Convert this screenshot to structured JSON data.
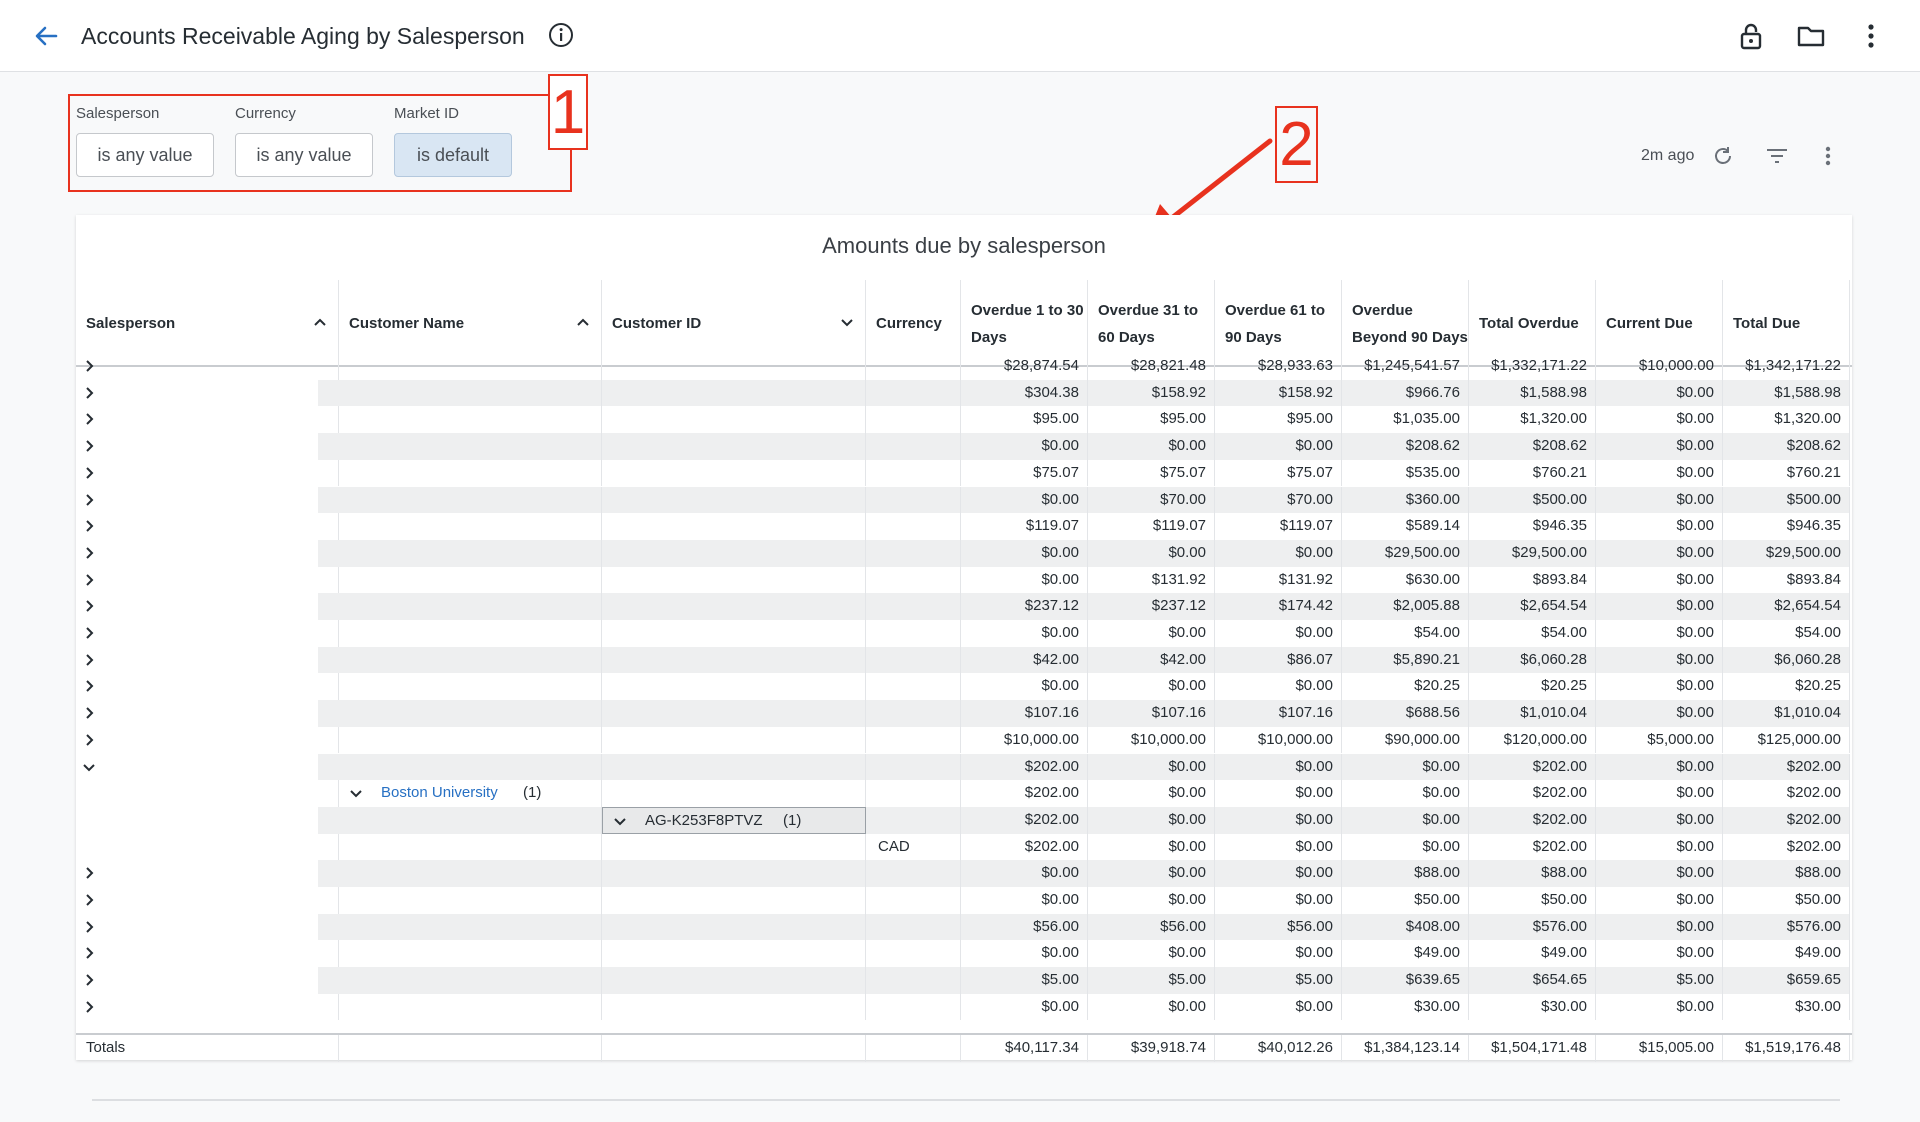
{
  "header": {
    "title": "Accounts Receivable Aging by Salesperson"
  },
  "filters": [
    {
      "label": "Salesperson",
      "value": "is any value"
    },
    {
      "label": "Currency",
      "value": "is any value"
    },
    {
      "label": "Market ID",
      "value": "is default"
    }
  ],
  "annotations": [
    "1",
    "2"
  ],
  "toolbar": {
    "ago": "2m ago"
  },
  "tile": {
    "title": "Amounts due by salesperson",
    "columns": [
      "Salesperson",
      "Customer Name",
      "Customer ID",
      "Currency",
      "Overdue 1 to 30 Days",
      "Overdue 31 to 60 Days",
      "Overdue 61 to 90 Days",
      "Overdue Beyond 90 Days",
      "Total Overdue",
      "Current Due",
      "Total Due"
    ],
    "rows": [
      {
        "v": [
          "$28,874.54",
          "$28,821.48",
          "$28,933.63",
          "$1,245,541.57",
          "$1,332,171.22",
          "$10,000.00",
          "$1,342,171.22"
        ]
      },
      {
        "v": [
          "$304.38",
          "$158.92",
          "$158.92",
          "$966.76",
          "$1,588.98",
          "$0.00",
          "$1,588.98"
        ]
      },
      {
        "v": [
          "$95.00",
          "$95.00",
          "$95.00",
          "$1,035.00",
          "$1,320.00",
          "$0.00",
          "$1,320.00"
        ]
      },
      {
        "v": [
          "$0.00",
          "$0.00",
          "$0.00",
          "$208.62",
          "$208.62",
          "$0.00",
          "$208.62"
        ]
      },
      {
        "v": [
          "$75.07",
          "$75.07",
          "$75.07",
          "$535.00",
          "$760.21",
          "$0.00",
          "$760.21"
        ]
      },
      {
        "v": [
          "$0.00",
          "$70.00",
          "$70.00",
          "$360.00",
          "$500.00",
          "$0.00",
          "$500.00"
        ]
      },
      {
        "v": [
          "$119.07",
          "$119.07",
          "$119.07",
          "$589.14",
          "$946.35",
          "$0.00",
          "$946.35"
        ]
      },
      {
        "v": [
          "$0.00",
          "$0.00",
          "$0.00",
          "$29,500.00",
          "$29,500.00",
          "$0.00",
          "$29,500.00"
        ]
      },
      {
        "v": [
          "$0.00",
          "$131.92",
          "$131.92",
          "$630.00",
          "$893.84",
          "$0.00",
          "$893.84"
        ]
      },
      {
        "v": [
          "$237.12",
          "$237.12",
          "$174.42",
          "$2,005.88",
          "$2,654.54",
          "$0.00",
          "$2,654.54"
        ]
      },
      {
        "v": [
          "$0.00",
          "$0.00",
          "$0.00",
          "$54.00",
          "$54.00",
          "$0.00",
          "$54.00"
        ]
      },
      {
        "v": [
          "$42.00",
          "$42.00",
          "$86.07",
          "$5,890.21",
          "$6,060.28",
          "$0.00",
          "$6,060.28"
        ]
      },
      {
        "v": [
          "$0.00",
          "$0.00",
          "$0.00",
          "$20.25",
          "$20.25",
          "$0.00",
          "$20.25"
        ]
      },
      {
        "v": [
          "$107.16",
          "$107.16",
          "$107.16",
          "$688.56",
          "$1,010.04",
          "$0.00",
          "$1,010.04"
        ]
      },
      {
        "v": [
          "$10,000.00",
          "$10,000.00",
          "$10,000.00",
          "$90,000.00",
          "$120,000.00",
          "$5,000.00",
          "$125,000.00"
        ]
      },
      {
        "v": [
          "$202.00",
          "$0.00",
          "$0.00",
          "$0.00",
          "$202.00",
          "$0.00",
          "$202.00"
        ],
        "expanded": true
      },
      {
        "v": [
          "$202.00",
          "$0.00",
          "$0.00",
          "$0.00",
          "$202.00",
          "$0.00",
          "$202.00"
        ],
        "customer": "Boston University",
        "count": "(1)"
      },
      {
        "v": [
          "$202.00",
          "$0.00",
          "$0.00",
          "$0.00",
          "$202.00",
          "$0.00",
          "$202.00"
        ],
        "customer_id": "AG-K253F8PTVZ",
        "count": "(1)"
      },
      {
        "v": [
          "$202.00",
          "$0.00",
          "$0.00",
          "$0.00",
          "$202.00",
          "$0.00",
          "$202.00"
        ],
        "currency": "CAD"
      },
      {
        "v": [
          "$0.00",
          "$0.00",
          "$0.00",
          "$88.00",
          "$88.00",
          "$0.00",
          "$88.00"
        ]
      },
      {
        "v": [
          "$0.00",
          "$0.00",
          "$0.00",
          "$50.00",
          "$50.00",
          "$0.00",
          "$50.00"
        ]
      },
      {
        "v": [
          "$56.00",
          "$56.00",
          "$56.00",
          "$408.00",
          "$576.00",
          "$0.00",
          "$576.00"
        ]
      },
      {
        "v": [
          "$0.00",
          "$0.00",
          "$0.00",
          "$49.00",
          "$49.00",
          "$0.00",
          "$49.00"
        ]
      },
      {
        "v": [
          "$5.00",
          "$5.00",
          "$5.00",
          "$639.65",
          "$654.65",
          "$5.00",
          "$659.65"
        ]
      },
      {
        "v": [
          "$0.00",
          "$0.00",
          "$0.00",
          "$30.00",
          "$30.00",
          "$0.00",
          "$30.00"
        ]
      }
    ],
    "totals": {
      "label": "Totals",
      "v": [
        "$40,117.34",
        "$39,918.74",
        "$40,012.26",
        "$1,384,123.14",
        "$1,504,171.48",
        "$15,005.00",
        "$1,519,176.48"
      ]
    }
  }
}
